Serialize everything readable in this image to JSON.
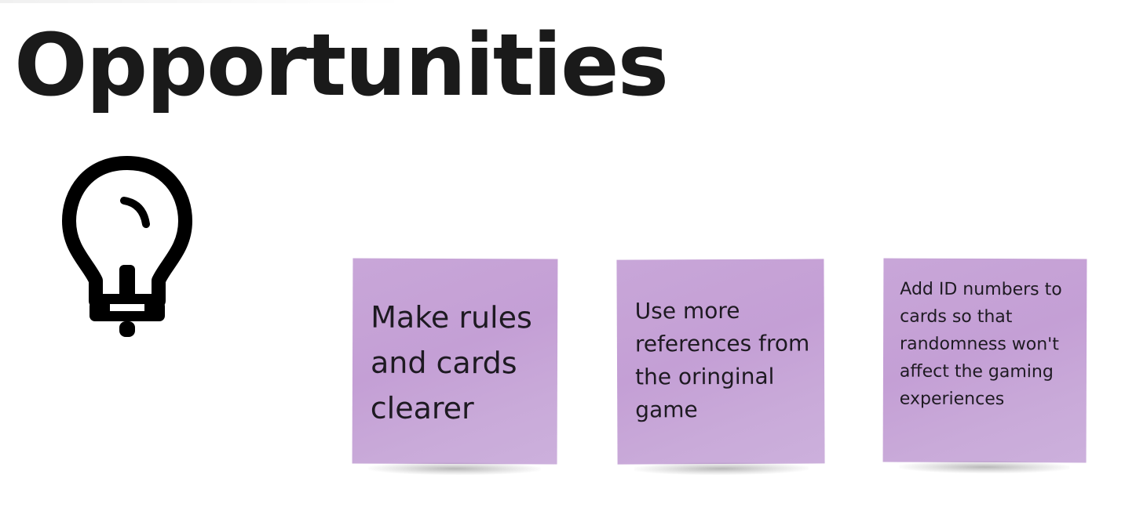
{
  "board": {
    "title": "Opportunities",
    "icon": "lightbulb-icon"
  },
  "sticky_notes": [
    {
      "text": "Make rules and cards clearer",
      "color": "#c6a3d6"
    },
    {
      "text": "Use more references from the oringinal game",
      "color": "#c6a3d6"
    },
    {
      "text": "Add ID numbers to cards so that randomness won't affect the gaming experiences",
      "color": "#c6a3d6"
    }
  ]
}
